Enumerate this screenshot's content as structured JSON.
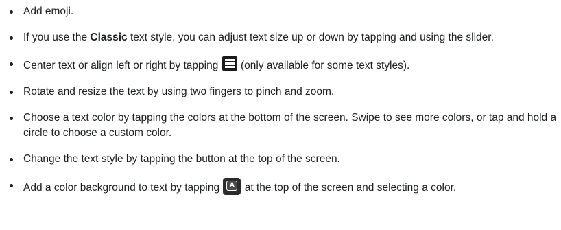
{
  "items": [
    {
      "text": "Add emoji."
    },
    {
      "before": "If you use the ",
      "bold": "Classic",
      "after": " text style, you can adjust text size up or down by tapping and using the slider."
    },
    {
      "before": "Center text or align left or right by tapping ",
      "icon": "align-text-icon",
      "after": " (only available for some text styles)."
    },
    {
      "text": "Rotate and resize the text by using two fingers to pinch and zoom."
    },
    {
      "text": "Choose a text color by tapping the colors at the bottom of the screen. Swipe to see more colors, or tap and hold a circle to choose a custom color."
    },
    {
      "text": "Change the text style by tapping the button at the top of the screen."
    },
    {
      "before": "Add a color background to text by tapping ",
      "icon": "text-background-icon",
      "icon_letter": "A",
      "after": " at the top of the screen and selecting a color."
    }
  ],
  "colors": {
    "text": "#1c1e21",
    "icon_bg": "#1b1b1b"
  }
}
